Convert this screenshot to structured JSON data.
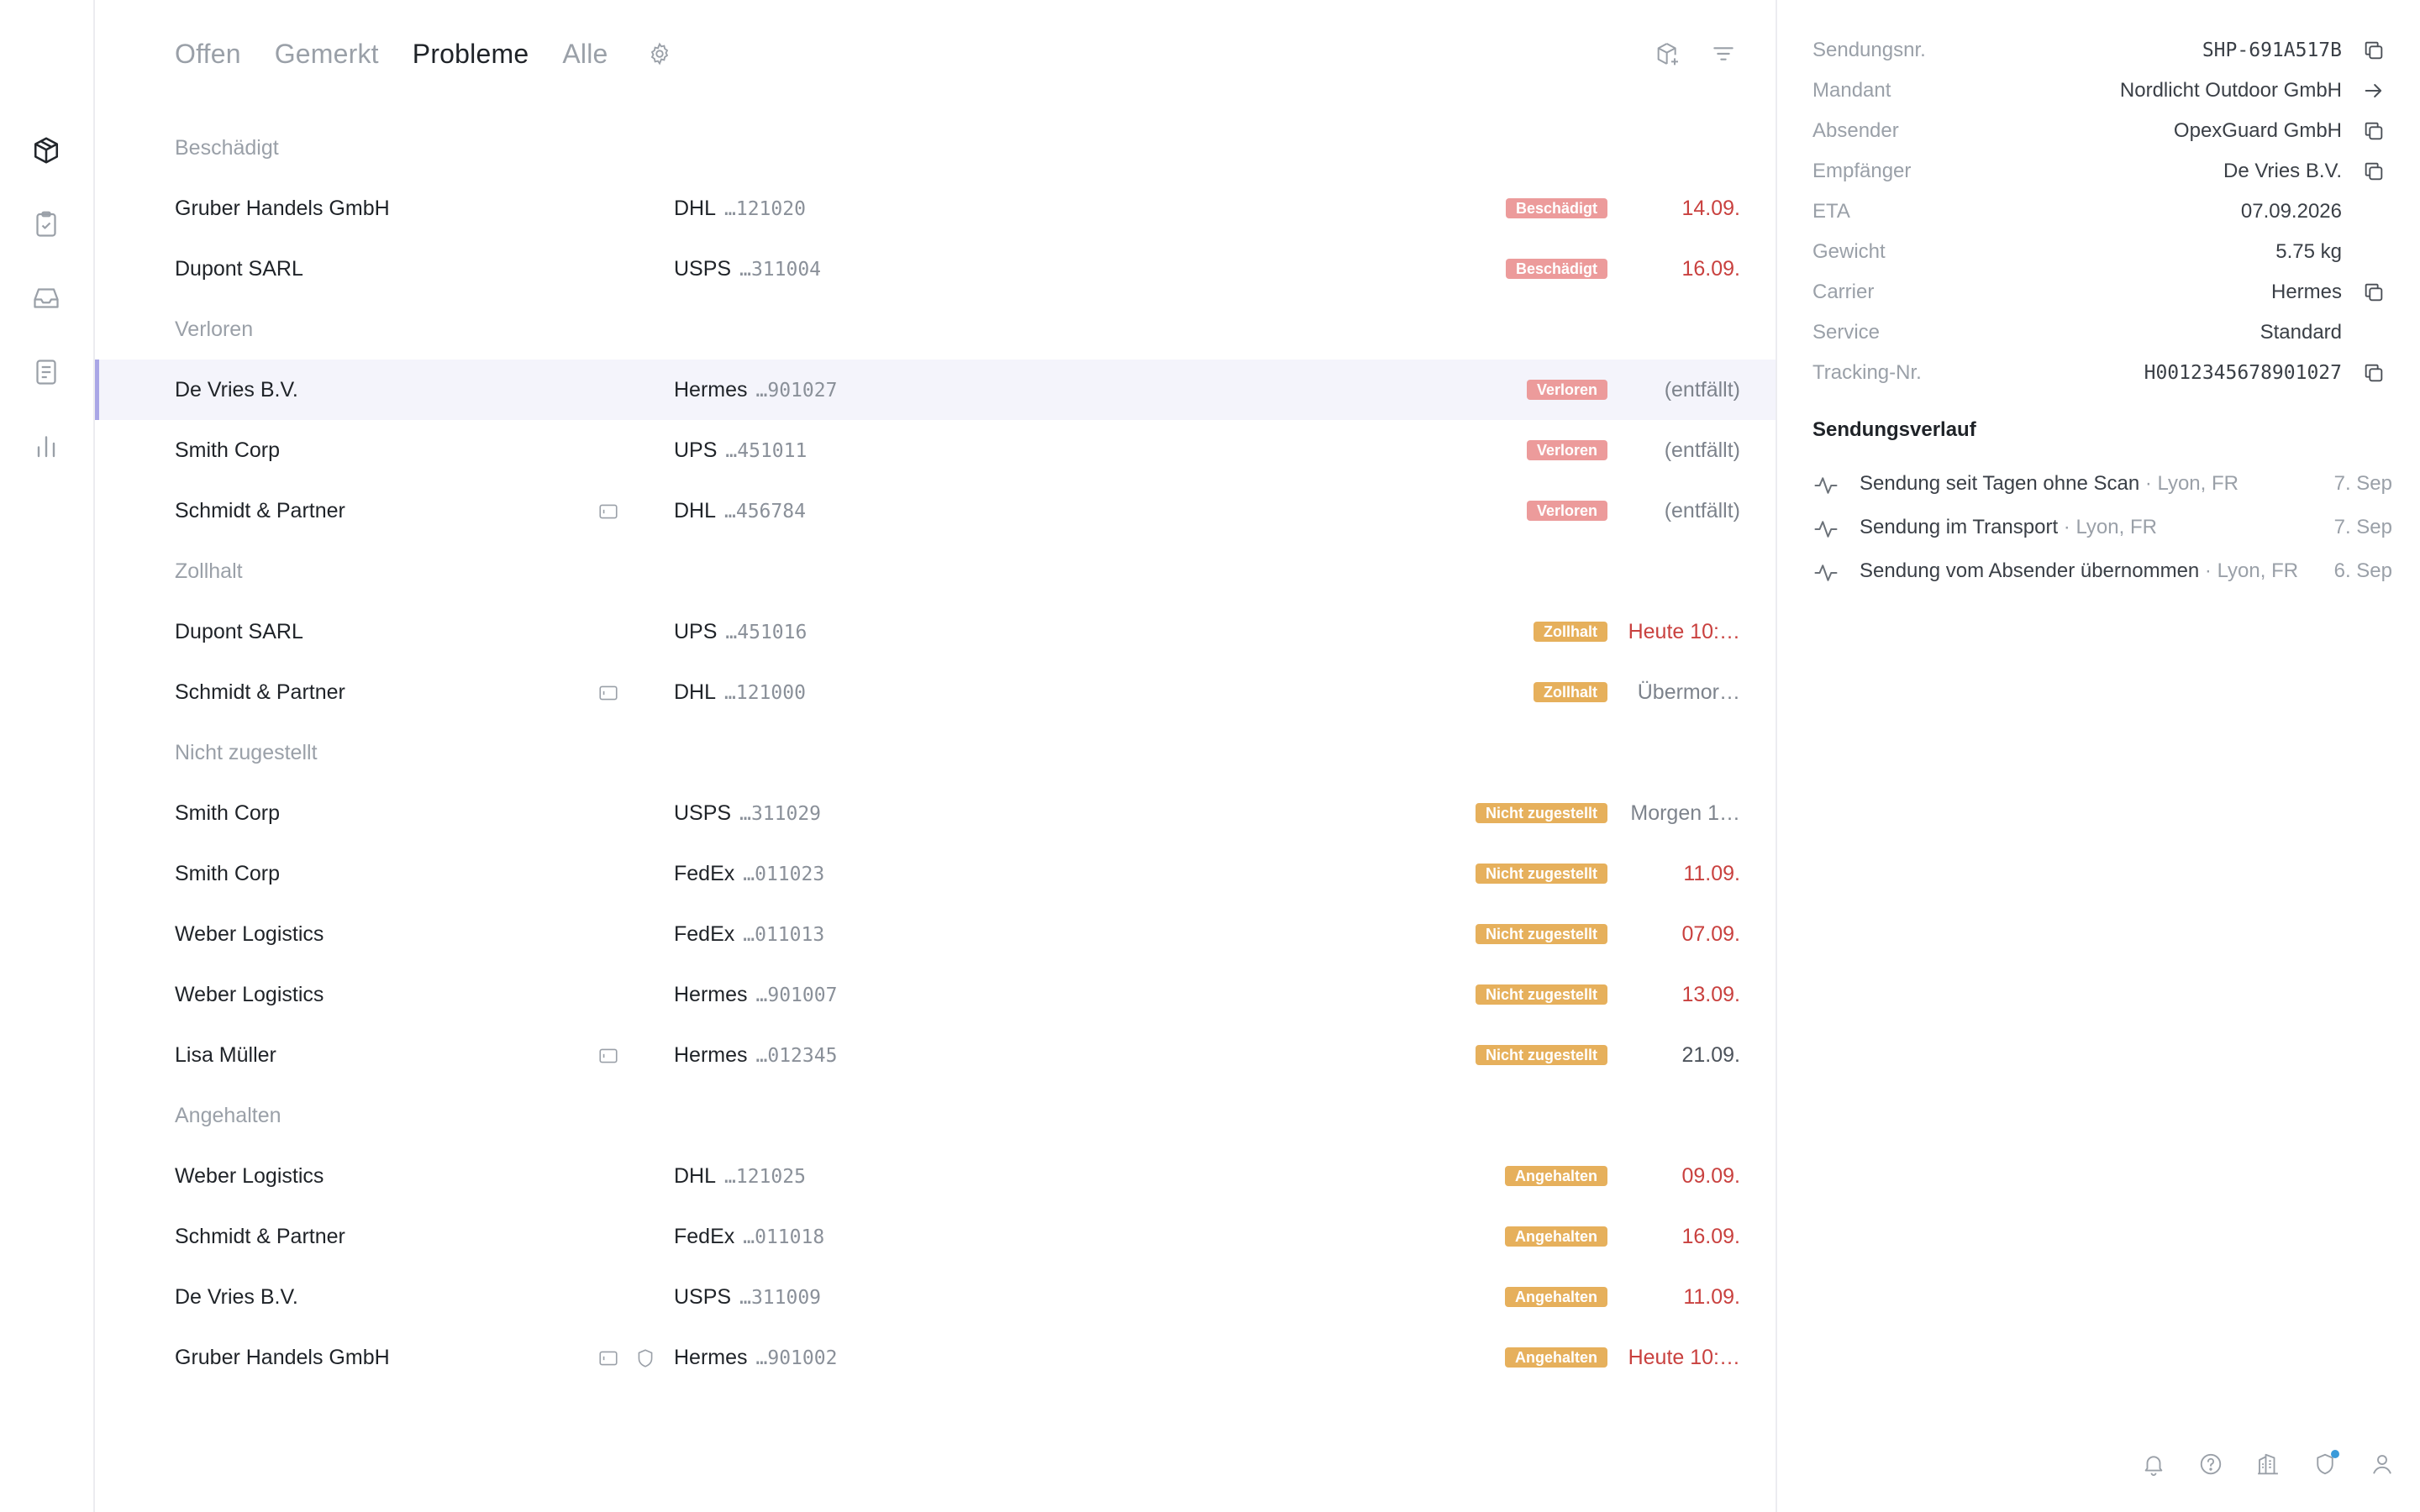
{
  "nav": {
    "items": [
      {
        "icon": "package-icon",
        "active": true
      },
      {
        "icon": "clipboard-check-icon",
        "active": false
      },
      {
        "icon": "inbox-icon",
        "active": false
      },
      {
        "icon": "document-icon",
        "active": false
      },
      {
        "icon": "bar-chart-icon",
        "active": false
      }
    ]
  },
  "tabs": [
    {
      "label": "Offen",
      "active": false
    },
    {
      "label": "Gemerkt",
      "active": false
    },
    {
      "label": "Probleme",
      "active": true
    },
    {
      "label": "Alle",
      "active": false
    }
  ],
  "groups": [
    {
      "title": "Beschädigt",
      "rows": [
        {
          "name": "Gruber Handels GmbH",
          "carrier": "DHL",
          "tracking": "…121020",
          "badge": "Beschädigt",
          "badge_color": "red",
          "date": "14.09.",
          "date_style": "red",
          "flags": []
        },
        {
          "name": "Dupont SARL",
          "carrier": "USPS",
          "tracking": "…311004",
          "badge": "Beschädigt",
          "badge_color": "red",
          "date": "16.09.",
          "date_style": "red",
          "flags": []
        }
      ]
    },
    {
      "title": "Verloren",
      "rows": [
        {
          "name": "De Vries B.V.",
          "carrier": "Hermes",
          "tracking": "…901027",
          "badge": "Verloren",
          "badge_color": "red",
          "date": "(entfällt)",
          "date_style": "gray",
          "flags": [],
          "selected": true
        },
        {
          "name": "Smith Corp",
          "carrier": "UPS",
          "tracking": "…451011",
          "badge": "Verloren",
          "badge_color": "red",
          "date": "(entfällt)",
          "date_style": "gray",
          "flags": []
        },
        {
          "name": "Schmidt & Partner",
          "carrier": "DHL",
          "tracking": "…456784",
          "badge": "Verloren",
          "badge_color": "red",
          "date": "(entfällt)",
          "date_style": "gray",
          "flags": [
            "card-icon"
          ]
        }
      ]
    },
    {
      "title": "Zollhalt",
      "rows": [
        {
          "name": "Dupont SARL",
          "carrier": "UPS",
          "tracking": "…451016",
          "badge": "Zollhalt",
          "badge_color": "amber",
          "date": "Heute 10:…",
          "date_style": "red",
          "flags": []
        },
        {
          "name": "Schmidt & Partner",
          "carrier": "DHL",
          "tracking": "…121000",
          "badge": "Zollhalt",
          "badge_color": "amber",
          "date": "Übermor…",
          "date_style": "gray",
          "flags": [
            "card-icon"
          ]
        }
      ]
    },
    {
      "title": "Nicht zugestellt",
      "rows": [
        {
          "name": "Smith Corp",
          "carrier": "USPS",
          "tracking": "…311029",
          "badge": "Nicht zugestellt",
          "badge_color": "amber",
          "date": "Morgen 1…",
          "date_style": "gray",
          "flags": []
        },
        {
          "name": "Smith Corp",
          "carrier": "FedEx",
          "tracking": "…011023",
          "badge": "Nicht zugestellt",
          "badge_color": "amber",
          "date": "11.09.",
          "date_style": "red",
          "flags": []
        },
        {
          "name": "Weber Logistics",
          "carrier": "FedEx",
          "tracking": "…011013",
          "badge": "Nicht zugestellt",
          "badge_color": "amber",
          "date": "07.09.",
          "date_style": "red",
          "flags": []
        },
        {
          "name": "Weber Logistics",
          "carrier": "Hermes",
          "tracking": "…901007",
          "badge": "Nicht zugestellt",
          "badge_color": "amber",
          "date": "13.09.",
          "date_style": "red",
          "flags": []
        },
        {
          "name": "Lisa Müller",
          "carrier": "Hermes",
          "tracking": "…012345",
          "badge": "Nicht zugestellt",
          "badge_color": "amber",
          "date": "21.09.",
          "date_style": "dark",
          "flags": [
            "card-icon"
          ]
        }
      ]
    },
    {
      "title": "Angehalten",
      "rows": [
        {
          "name": "Weber Logistics",
          "carrier": "DHL",
          "tracking": "…121025",
          "badge": "Angehalten",
          "badge_color": "amber",
          "date": "09.09.",
          "date_style": "red",
          "flags": []
        },
        {
          "name": "Schmidt & Partner",
          "carrier": "FedEx",
          "tracking": "…011018",
          "badge": "Angehalten",
          "badge_color": "amber",
          "date": "16.09.",
          "date_style": "red",
          "flags": []
        },
        {
          "name": "De Vries B.V.",
          "carrier": "USPS",
          "tracking": "…311009",
          "badge": "Angehalten",
          "badge_color": "amber",
          "date": "11.09.",
          "date_style": "red",
          "flags": []
        },
        {
          "name": "Gruber Handels GmbH",
          "carrier": "Hermes",
          "tracking": "…901002",
          "badge": "Angehalten",
          "badge_color": "amber",
          "date": "Heute 10:…",
          "date_style": "red",
          "flags": [
            "card-icon",
            "shield-icon"
          ]
        }
      ]
    }
  ],
  "detail": {
    "fields": [
      {
        "label": "Sendungsnr.",
        "value": "SHP-691A517B",
        "mono": true,
        "action": "copy-icon"
      },
      {
        "label": "Mandant",
        "value": "Nordlicht Outdoor GmbH",
        "mono": false,
        "action": "arrow-right-icon"
      },
      {
        "label": "Absender",
        "value": "OpexGuard GmbH",
        "mono": false,
        "action": "copy-icon"
      },
      {
        "label": "Empfänger",
        "value": "De Vries B.V.",
        "mono": false,
        "action": "copy-icon"
      },
      {
        "label": "ETA",
        "value": "07.09.2026",
        "mono": false,
        "action": ""
      },
      {
        "label": "Gewicht",
        "value": "5.75 kg",
        "mono": false,
        "action": ""
      },
      {
        "label": "Carrier",
        "value": "Hermes",
        "mono": false,
        "action": "copy-icon"
      },
      {
        "label": "Service",
        "value": "Standard",
        "mono": false,
        "action": ""
      },
      {
        "label": "Tracking-Nr.",
        "value": "H0012345678901027",
        "mono": true,
        "action": "copy-icon"
      }
    ],
    "history_title": "Sendungsverlauf",
    "history": [
      {
        "text": "Sendung seit Tagen ohne Scan",
        "location": " · Lyon, FR",
        "date": "7. Sep"
      },
      {
        "text": "Sendung im Transport",
        "location": " · Lyon, FR",
        "date": "7. Sep"
      },
      {
        "text": "Sendung vom Absender übernommen",
        "location": " · Lyon, FR",
        "date": "6. Sep"
      }
    ]
  },
  "footer_icons": [
    "bell-icon",
    "help-icon",
    "building-icon",
    "shield-notification-icon",
    "user-icon"
  ],
  "colors": {
    "accent": "#a9a6e6",
    "badge_red": "#ec9b9b",
    "badge_amber": "#e6b05c",
    "date_red": "#c9413f",
    "notification_dot": "#3a9ad9"
  }
}
